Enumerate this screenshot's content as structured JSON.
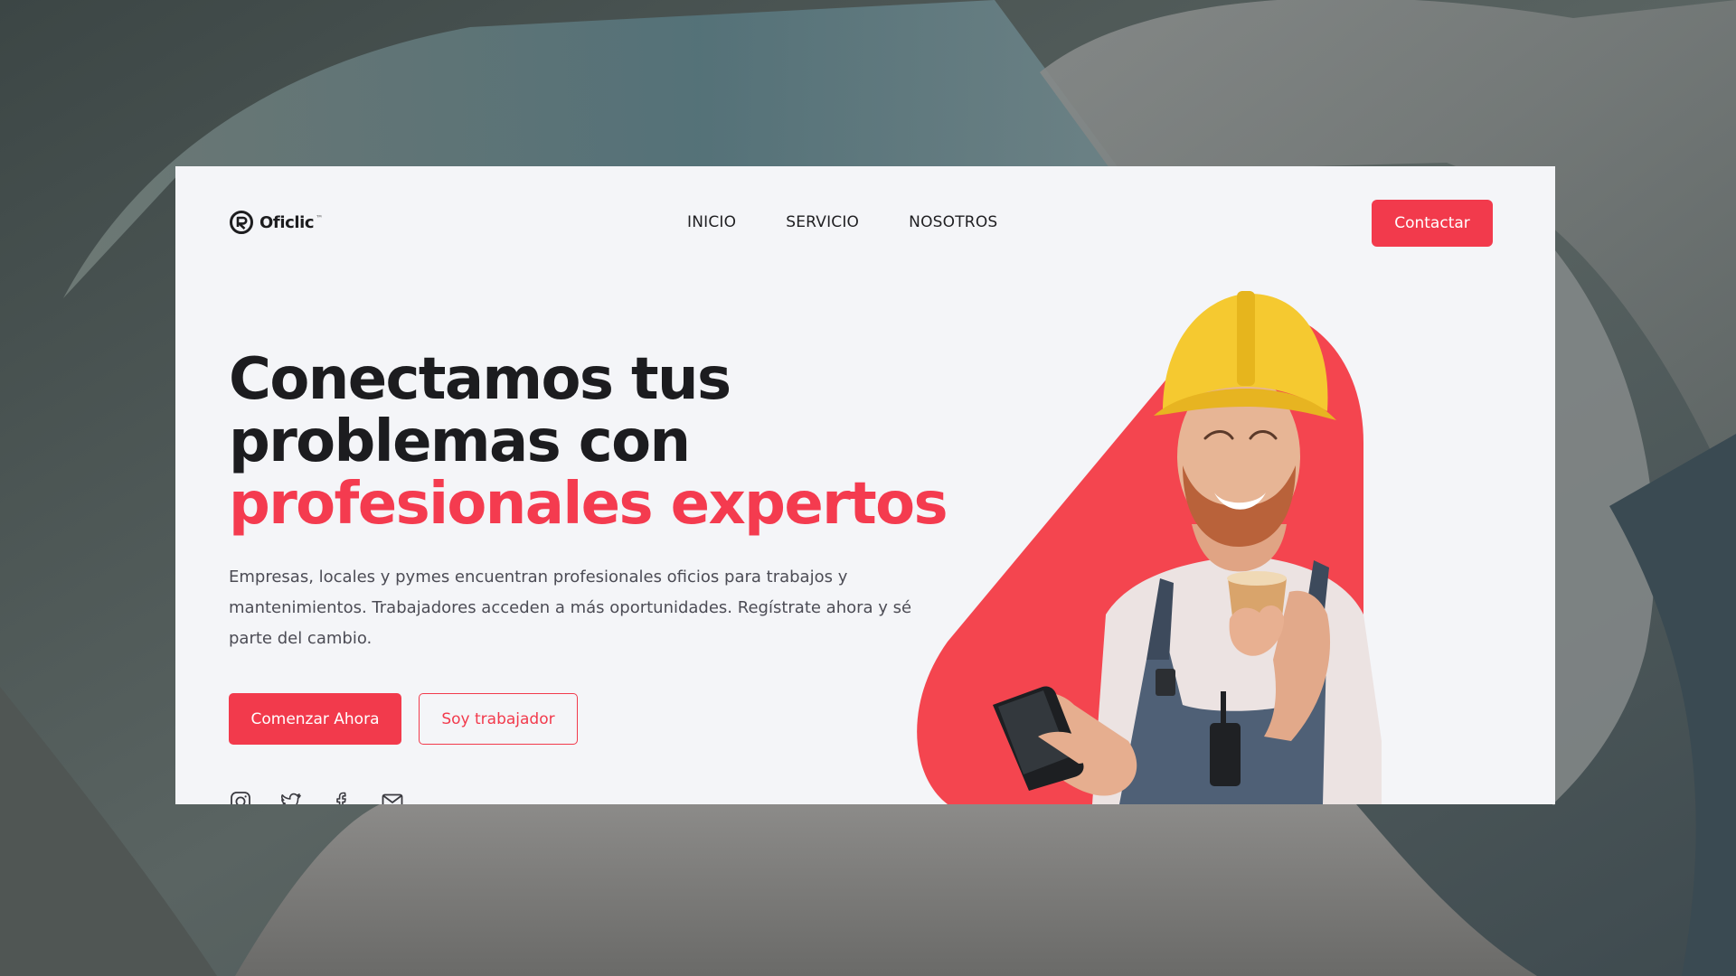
{
  "brand": {
    "name": "Oficlic",
    "tm": "™",
    "accent_color": "#f23a4c"
  },
  "nav": {
    "items": [
      {
        "label": "INICIO"
      },
      {
        "label": "SERVICIO"
      },
      {
        "label": "NOSOTROS"
      }
    ],
    "contact_label": "Contactar"
  },
  "hero": {
    "title_line1": "Conectamos tus",
    "title_line2": "problemas con",
    "title_accent": "profesionales expertos",
    "description": "Empresas, locales y pymes encuentran profesionales oficios para trabajos y mantenimientos. Trabajadores acceden a más oportunidades. Regístrate ahora y sé parte del cambio.",
    "primary_cta": "Comenzar Ahora",
    "secondary_cta": "Soy trabajador"
  },
  "socials": [
    {
      "icon": "instagram-icon"
    },
    {
      "icon": "twitter-icon"
    },
    {
      "icon": "facebook-icon"
    },
    {
      "icon": "mail-icon"
    }
  ],
  "hero_image": {
    "subject": "worker-photo",
    "blob_color": "#f4454f",
    "helmet_color": "#f5c930"
  }
}
